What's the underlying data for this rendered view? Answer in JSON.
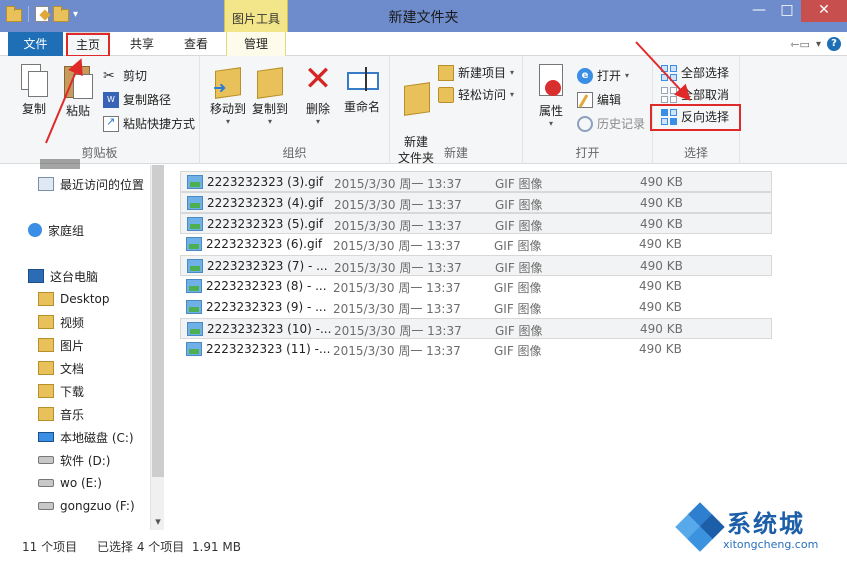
{
  "window": {
    "title": "新建文件夹",
    "context_tab_header": "图片工具",
    "minimize": "—",
    "maximize": "□",
    "close": "✕"
  },
  "tabs": {
    "file": "文件",
    "home": "主页",
    "share": "共享",
    "view": "查看",
    "manage": "管理",
    "help": "?"
  },
  "ribbon": {
    "clipboard": {
      "label": "剪贴板",
      "copy": "复制",
      "paste": "粘贴",
      "cut": "剪切",
      "copy_path": "复制路径",
      "paste_shortcut": "粘贴快捷方式"
    },
    "organize": {
      "label": "组织",
      "move_to": "移动到",
      "copy_to": "复制到",
      "delete": "删除",
      "rename": "重命名"
    },
    "new": {
      "label": "新建",
      "new_folder": "新建\n文件夹",
      "new_item": "新建项目",
      "easy_access": "轻松访问"
    },
    "open": {
      "label": "打开",
      "properties": "属性",
      "open": "打开",
      "edit": "编辑",
      "history": "历史记录"
    },
    "select": {
      "label": "选择",
      "select_all": "全部选择",
      "select_none": "全部取消",
      "invert": "反向选择"
    }
  },
  "nav": {
    "items": [
      {
        "label": "最近访问的位置",
        "icon": "recent-icon"
      },
      {
        "label": "家庭组",
        "icon": "homegroup-icon"
      },
      {
        "label": "这台电脑",
        "icon": "computer-icon"
      },
      {
        "label": "Desktop",
        "icon": "folder-icon"
      },
      {
        "label": "视频",
        "icon": "folder-icon"
      },
      {
        "label": "图片",
        "icon": "folder-icon"
      },
      {
        "label": "文档",
        "icon": "folder-icon"
      },
      {
        "label": "下载",
        "icon": "folder-icon"
      },
      {
        "label": "音乐",
        "icon": "folder-icon"
      },
      {
        "label": "本地磁盘 (C:)",
        "icon": "system-drive-icon"
      },
      {
        "label": "软件 (D:)",
        "icon": "drive-icon"
      },
      {
        "label": "wo (E:)",
        "icon": "drive-icon"
      },
      {
        "label": "gongzuo (F:)",
        "icon": "drive-icon"
      }
    ]
  },
  "files": [
    {
      "name": "2223232323 (3).gif",
      "date": "2015/3/30 周一 13:37",
      "type": "GIF 图像",
      "size": "490 KB",
      "selected": true
    },
    {
      "name": "2223232323 (4).gif",
      "date": "2015/3/30 周一 13:37",
      "type": "GIF 图像",
      "size": "490 KB",
      "selected": true
    },
    {
      "name": "2223232323 (5).gif",
      "date": "2015/3/30 周一 13:37",
      "type": "GIF 图像",
      "size": "490 KB",
      "selected": true
    },
    {
      "name": "2223232323 (6).gif",
      "date": "2015/3/30 周一 13:37",
      "type": "GIF 图像",
      "size": "490 KB",
      "selected": false
    },
    {
      "name": "2223232323 (7) - ...",
      "date": "2015/3/30 周一 13:37",
      "type": "GIF 图像",
      "size": "490 KB",
      "selected": true
    },
    {
      "name": "2223232323 (8) - ...",
      "date": "2015/3/30 周一 13:37",
      "type": "GIF 图像",
      "size": "490 KB",
      "selected": false
    },
    {
      "name": "2223232323 (9) - ...",
      "date": "2015/3/30 周一 13:37",
      "type": "GIF 图像",
      "size": "490 KB",
      "selected": false
    },
    {
      "name": "2223232323 (10) -...",
      "date": "2015/3/30 周一 13:37",
      "type": "GIF 图像",
      "size": "490 KB",
      "selected": true
    },
    {
      "name": "2223232323 (11) -...",
      "date": "2015/3/30 周一 13:37",
      "type": "GIF 图像",
      "size": "490 KB",
      "selected": false
    }
  ],
  "status": {
    "count": "11 个项目",
    "selection": "已选择 4 个项目  1.91 MB"
  },
  "watermark": {
    "brand": "系统城",
    "url": "xitongcheng.com"
  },
  "colors": {
    "titlebar": "#6e8ccb",
    "file_tab": "#1f6fb7",
    "context_tab": "#f3e58a",
    "highlight_box": "#e02a2a",
    "close_button": "#c7504f"
  }
}
